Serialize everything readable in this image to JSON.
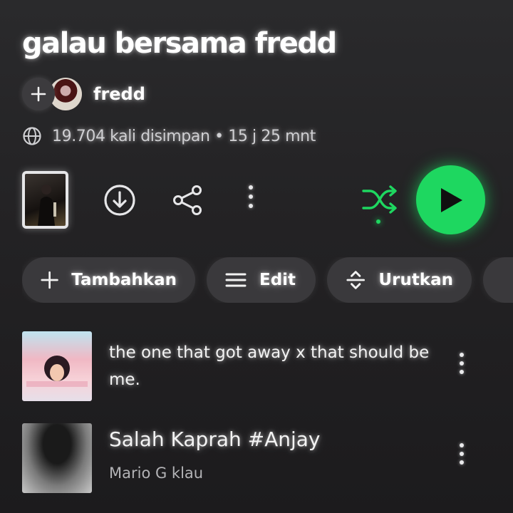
{
  "playlist": {
    "title": "galau bersama fredd",
    "owner": "fredd",
    "meta": "19.704 kali disimpan • 15 j 25 mnt"
  },
  "chips": [
    {
      "label": "Tambahkan",
      "icon": "plus-icon"
    },
    {
      "label": "Edit",
      "icon": "menu-icon"
    },
    {
      "label": "Urutkan",
      "icon": "sort-icon"
    }
  ],
  "tracks": [
    {
      "title": "the one that got away x that should be me.",
      "artist": ""
    },
    {
      "title": "Salah Kaprah #Anjay",
      "artist": "Mario G klau"
    }
  ],
  "colors": {
    "accent": "#1ed760",
    "background": "#2a2a2c",
    "chip_bg": "#3a393c"
  },
  "icons": [
    "plus-icon",
    "globe-icon",
    "download-icon",
    "share-icon",
    "more-vertical-icon",
    "shuffle-icon",
    "play-icon"
  ]
}
